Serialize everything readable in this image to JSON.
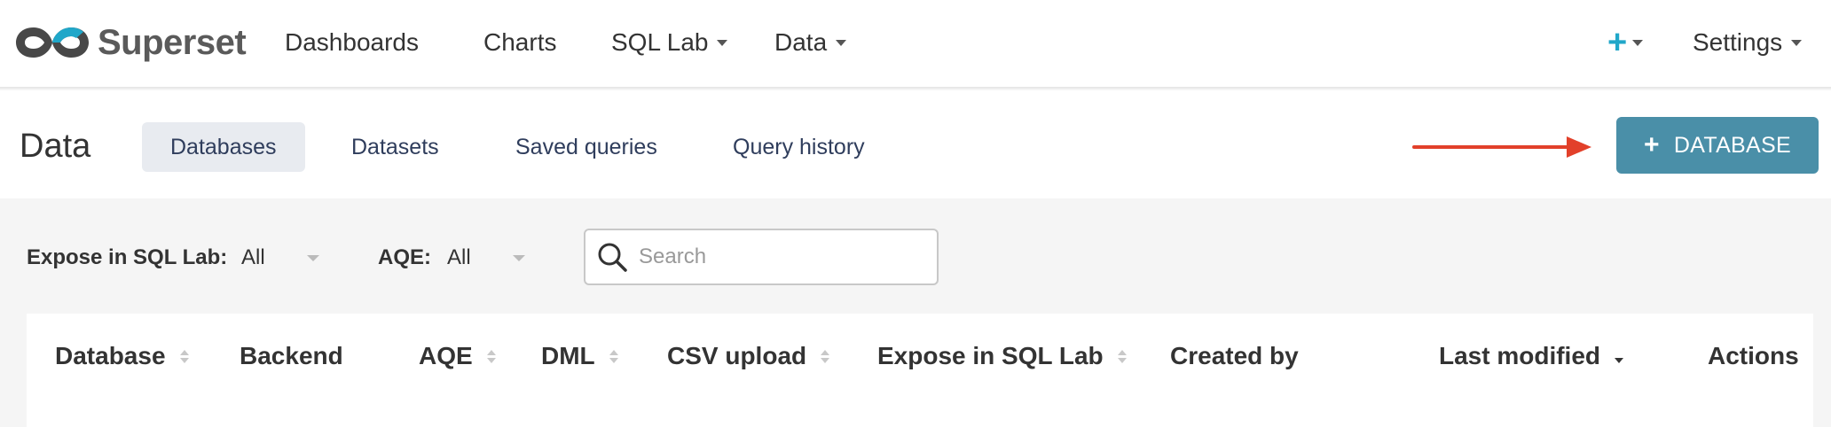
{
  "app": {
    "name": "Superset"
  },
  "colors": {
    "accent": "#20a7c9",
    "primary_button": "#4a8fa8",
    "arrow": "#e2402a"
  },
  "navbar": {
    "items": [
      {
        "label": "Dashboards",
        "has_caret": false
      },
      {
        "label": "Charts",
        "has_caret": false
      },
      {
        "label": "SQL Lab",
        "has_caret": true
      },
      {
        "label": "Data",
        "has_caret": true
      }
    ],
    "plus_icon": "plus-icon",
    "settings_label": "Settings"
  },
  "subheader": {
    "title": "Data",
    "tabs": [
      {
        "label": "Databases",
        "active": true
      },
      {
        "label": "Datasets",
        "active": false
      },
      {
        "label": "Saved queries",
        "active": false
      },
      {
        "label": "Query history",
        "active": false
      }
    ],
    "add_button_label": "DATABASE"
  },
  "filters": {
    "expose_label": "Expose in SQL Lab:",
    "expose_value": "All",
    "aqe_label": "AQE:",
    "aqe_value": "All",
    "search_placeholder": "Search"
  },
  "table": {
    "columns": [
      {
        "label": "Database",
        "sortable": true,
        "sort": "none"
      },
      {
        "label": "Backend",
        "sortable": false,
        "sort": "none"
      },
      {
        "label": "AQE",
        "sortable": true,
        "sort": "none"
      },
      {
        "label": "DML",
        "sortable": true,
        "sort": "none"
      },
      {
        "label": "CSV upload",
        "sortable": true,
        "sort": "none"
      },
      {
        "label": "Expose in SQL Lab",
        "sortable": true,
        "sort": "none"
      },
      {
        "label": "Created by",
        "sortable": false,
        "sort": "none"
      },
      {
        "label": "Last modified",
        "sortable": true,
        "sort": "desc"
      },
      {
        "label": "Actions",
        "sortable": false,
        "sort": "none"
      }
    ]
  }
}
